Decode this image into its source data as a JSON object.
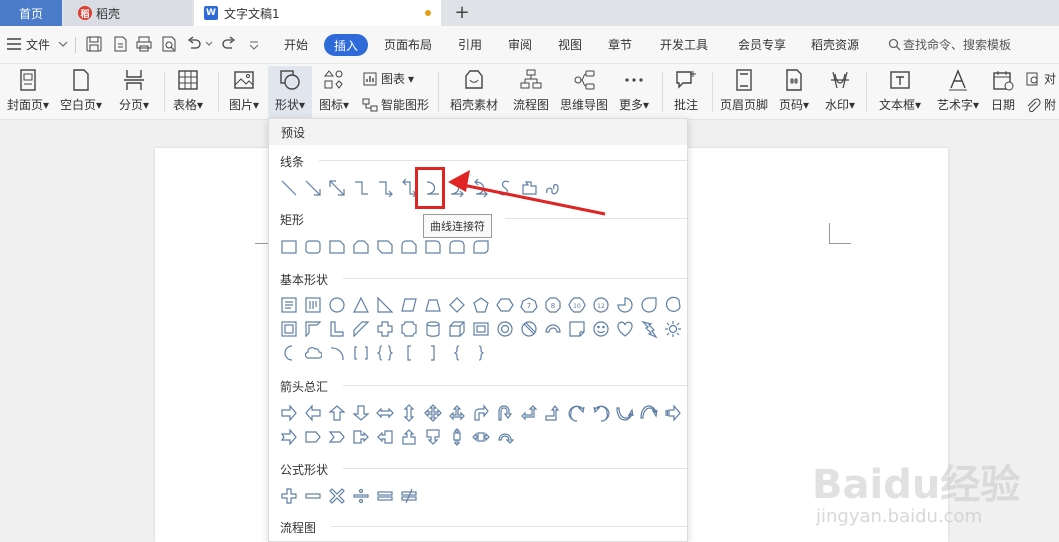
{
  "tabs": {
    "home": "首页",
    "daoke": "稻壳",
    "doc": "文字文稿1"
  },
  "menubar": {
    "file": "文件",
    "items": [
      "开始",
      "插入",
      "页面布局",
      "引用",
      "审阅",
      "视图",
      "章节",
      "开发工具",
      "会员专享",
      "稻壳资源"
    ],
    "active": "插入",
    "search_placeholder": "查找命令、搜索模板"
  },
  "ribbon": {
    "cover": "封面页",
    "blank": "空白页",
    "pagebreak": "分页",
    "table": "表格",
    "picture": "图片",
    "shape": "形状",
    "icon": "图标",
    "chart": "图表",
    "smartart": "智能图形",
    "daoke_material": "稻壳素材",
    "flowchart": "流程图",
    "mindmap": "思维导图",
    "more": "更多",
    "comment": "批注",
    "header_footer": "页眉页脚",
    "page_no": "页码",
    "watermark": "水印",
    "textbox": "文本框",
    "wordart": "艺术字",
    "date": "日期",
    "object": "对",
    "attach": "附"
  },
  "dropdown": {
    "header": "预设",
    "sections": {
      "lines": "线条",
      "rect": "矩形",
      "basic": "基本形状",
      "arrows": "箭头总汇",
      "formula": "公式形状",
      "flow": "流程图"
    },
    "tooltip": "曲线连接符"
  },
  "watermark": {
    "big": "Baidu经验",
    "small": "jingyan.baidu.com"
  },
  "colors": {
    "accent": "#2f6bd8",
    "highlight": "#e02323",
    "shape_stroke": "#5f7fa5"
  }
}
